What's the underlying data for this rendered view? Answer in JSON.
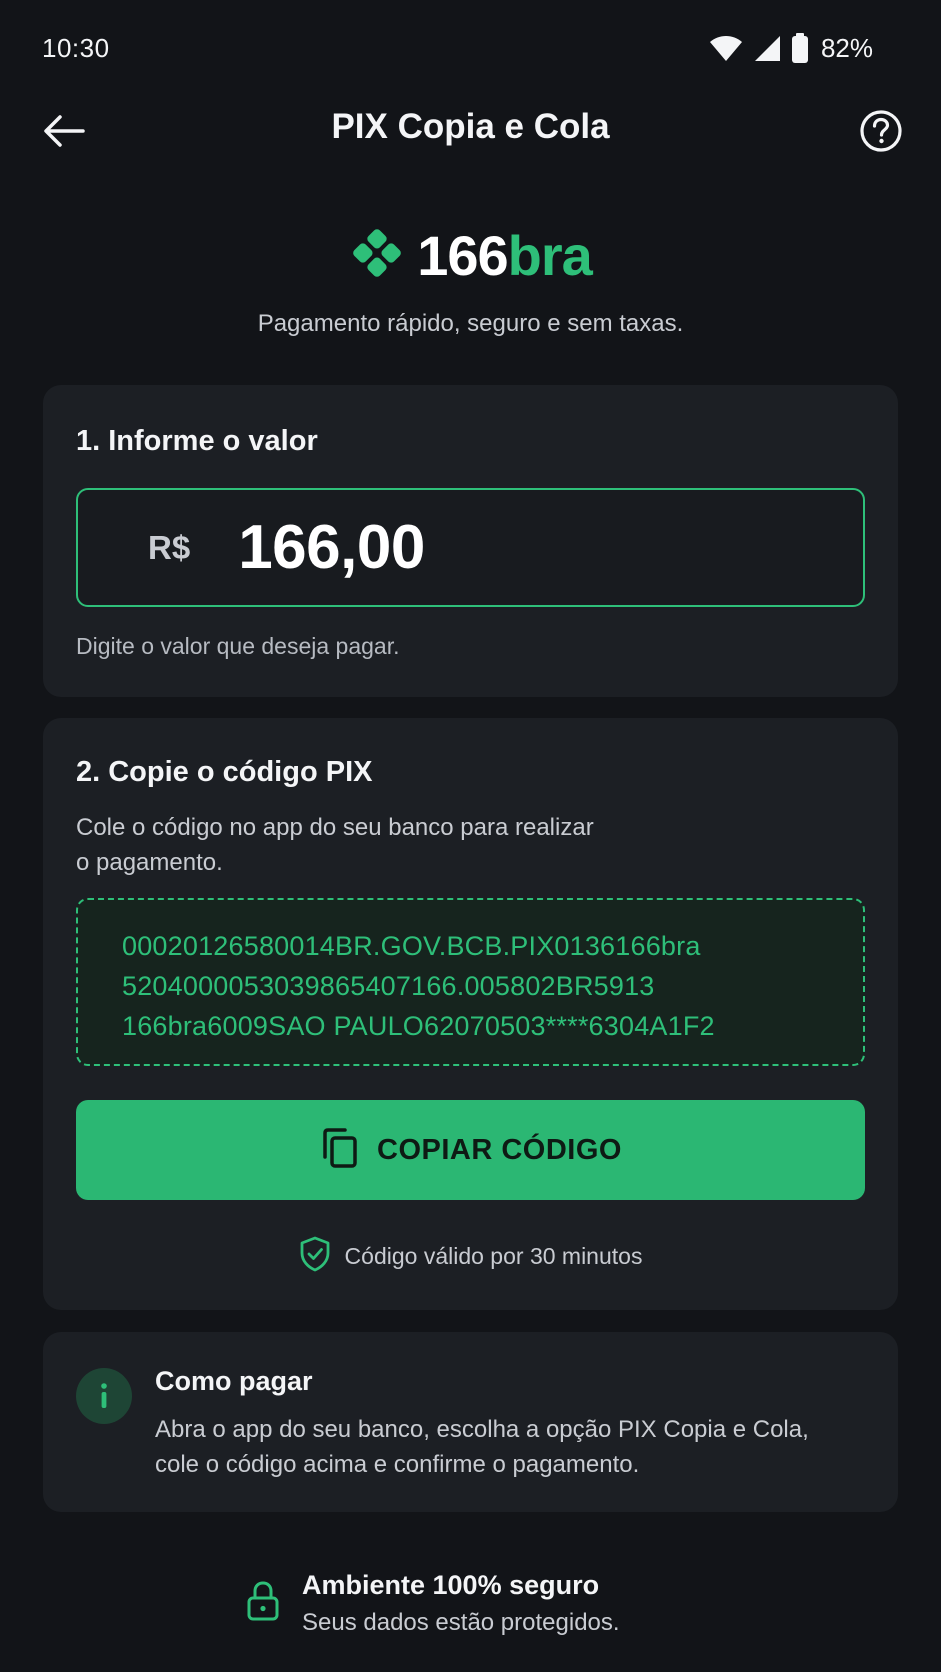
{
  "status_bar": {
    "time": "10:30",
    "battery": "82%"
  },
  "app_bar": {
    "title": "PIX Copia e Cola"
  },
  "brand": {
    "name_prefix": "166",
    "name_suffix": "bra",
    "tagline": "Pagamento rápido, seguro e sem taxas."
  },
  "amount_section": {
    "heading": "1. Informe o valor",
    "currency": "R$",
    "value": "166,00",
    "hint": "Digite o valor que deseja pagar."
  },
  "code_section": {
    "heading": "2. Copie o código PIX",
    "description": "Cole o código no app do seu banco para realizar o pagamento.",
    "pix_code_lines": [
      "00020126580014BR.GOV.BCB.PIX0136166bra",
      "5204000053039865407166.005802BR5913",
      "166bra6009SAO PAULO62070503****6304A1F2"
    ],
    "copy_button_label": "COPIAR CÓDIGO",
    "validity": "Código válido por 30 minutos"
  },
  "how_to_pay": {
    "title": "Como pagar",
    "text": "Abra o app do seu banco, escolha a opção PIX Copia e Cola, cole o código acima e confirme o pagamento."
  },
  "security": {
    "title": "Ambiente 100% seguro",
    "subtitle": "Seus dados estão protegidos."
  },
  "icons": {
    "back": "arrow-left-icon",
    "help": "help-circle-icon",
    "logo": "pix-diamond-logo",
    "copy": "copy-icon",
    "shield": "shield-check-icon",
    "info": "info-icon",
    "lock": "lock-icon",
    "wifi": "wifi-icon",
    "signal": "signal-icon",
    "battery": "battery-icon"
  },
  "colors": {
    "background": "#121418",
    "card": "#1c1f24",
    "accent": "#2ebf79",
    "button": "#2bb773"
  }
}
